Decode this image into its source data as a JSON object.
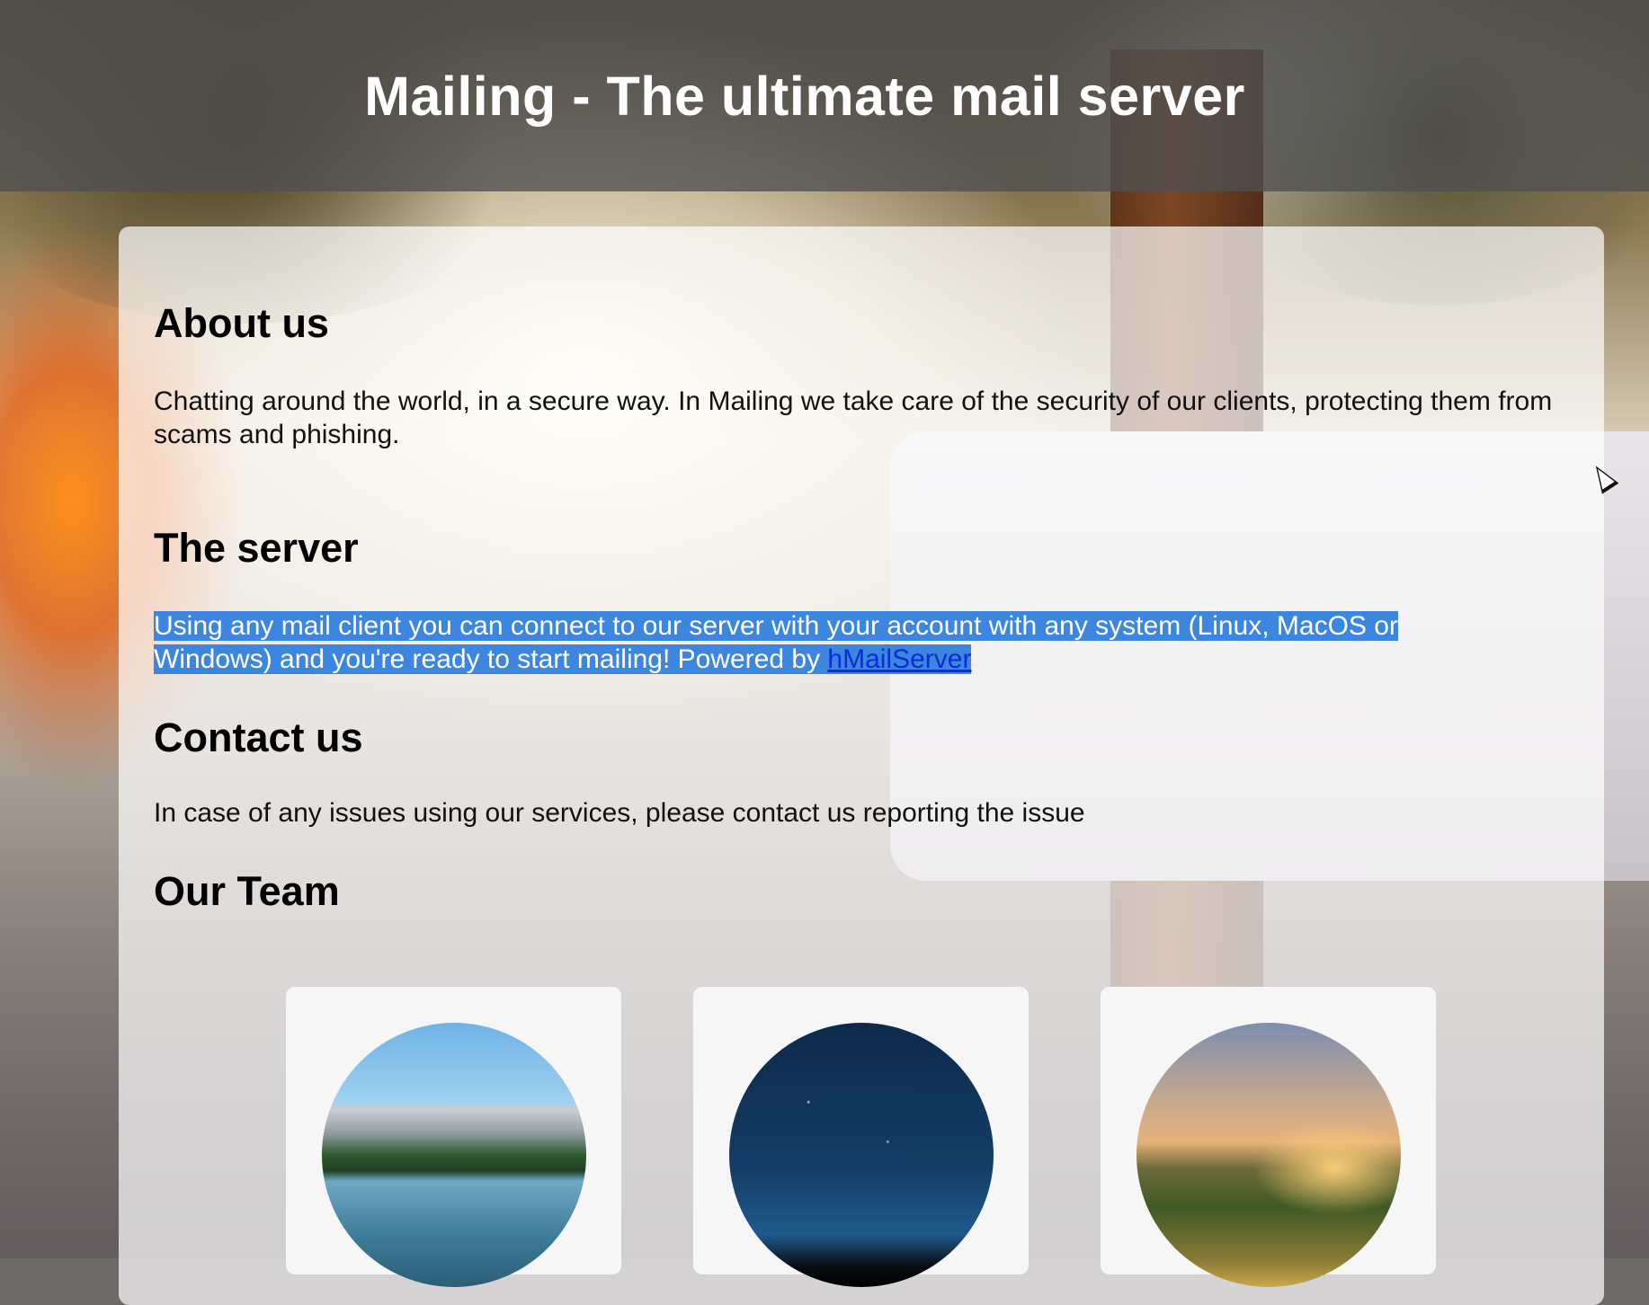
{
  "header": {
    "title": "Mailing - The ultimate mail server"
  },
  "sections": {
    "about": {
      "heading": "About us",
      "text": "Chatting around the world, in a secure way. In Mailing we take care of the security of our clients, protecting them from scams and phishing."
    },
    "server": {
      "heading": "The server",
      "text": "Using any mail client you can connect to our server with your account with any system (Linux, MacOS or Windows) and you're ready to start mailing! Powered by ",
      "link": "hMailServer"
    },
    "contact": {
      "heading": "Contact us",
      "text": "In case of any issues using our services, please contact us reporting the issue"
    },
    "team": {
      "heading": "Our Team"
    }
  },
  "team_members": [
    {
      "avatar_icon": "mountain-lake-photo"
    },
    {
      "avatar_icon": "starry-sky-photo"
    },
    {
      "avatar_icon": "sunset-hills-photo"
    }
  ],
  "colors": {
    "header_bg": "#505050",
    "selection": "#3d86e0",
    "link": "#0a2cd8"
  }
}
